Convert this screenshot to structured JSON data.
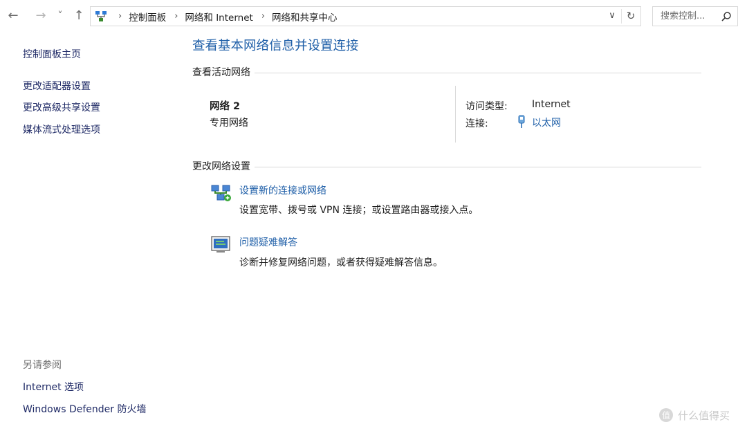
{
  "nav": {
    "back_glyph": "←",
    "forward_glyph": "→",
    "recent_glyph": "˅",
    "up_glyph": "↑"
  },
  "address": {
    "crumbs": [
      "控制面板",
      "网络和 Internet",
      "网络和共享中心"
    ],
    "separator": "›",
    "dropdown_glyph": "∨",
    "refresh_glyph": "↻"
  },
  "search": {
    "placeholder": "搜索控制..."
  },
  "sidebar": {
    "home": "控制面板主页",
    "items": [
      "更改适配器设置",
      "更改高级共享设置",
      "媒体流式处理选项"
    ],
    "see_also_header": "另请参阅",
    "see_also": [
      "Internet 选项",
      "Windows Defender 防火墙"
    ]
  },
  "main": {
    "title": "查看基本网络信息并设置连接",
    "active_networks": {
      "header": "查看活动网络",
      "network_name": "网络 2",
      "network_type": "专用网络",
      "access_type_label": "访问类型:",
      "access_type_value": "Internet",
      "connections_label": "连接:",
      "connection_link": "以太网"
    },
    "change_settings": {
      "header": "更改网络设置",
      "tasks": [
        {
          "link": "设置新的连接或网络",
          "description": "设置宽带、拨号或 VPN 连接；或设置路由器或接入点。"
        },
        {
          "link": "问题疑难解答",
          "description": "诊断并修复网络问题，或者获得疑难解答信息。"
        }
      ]
    }
  },
  "watermark": {
    "text": "什么值得买"
  },
  "colors": {
    "link_blue": "#1f5fa8",
    "sidebar_link": "#1f2a66",
    "muted_text": "#6d6d6d",
    "divider": "#d9d9d9"
  }
}
